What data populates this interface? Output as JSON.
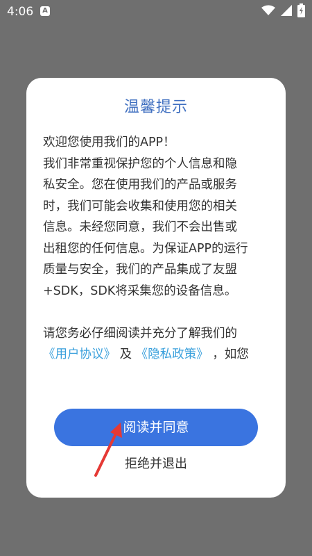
{
  "status_bar": {
    "time": "4:06",
    "notification_letter": "A"
  },
  "dialog": {
    "title": "温馨提示",
    "body_lines": [
      "欢迎您使用我们的APP！",
      "我们非常重视保护您的个人信息和隐",
      "私安全。您在使用我们的产品或服务",
      "时，我们可能会收集和使用您的相关",
      "信息。未经您同意，我们不会出售或",
      "出租您的任何信息。为保证APP的运行",
      "质量与安全，我们的产品集成了友盟",
      "+SDK，SDK将采集您的设备信息。"
    ],
    "read_line": "请您务必仔细阅读并充分了解我们的",
    "link_user_agreement": "《用户协议》",
    "and_text": "及",
    "link_privacy_policy": "《隐私政策》",
    "tail_text": "，如您",
    "agree_label": "阅读并同意",
    "reject_label": "拒绝并退出"
  },
  "colors": {
    "overlay": "#6f6f6f",
    "title": "#3f6fc0",
    "button": "#3a74e0",
    "link": "#3aa0dc",
    "annotation_arrow": "#e53935"
  }
}
